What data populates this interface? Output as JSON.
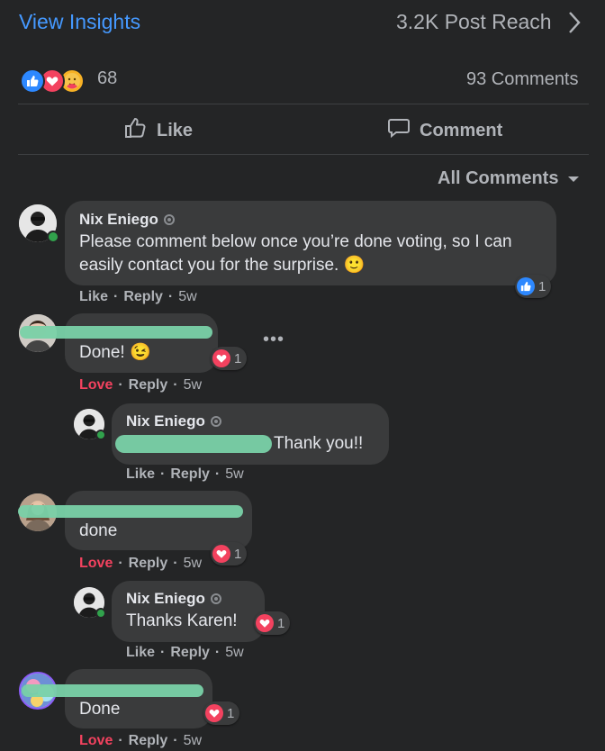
{
  "header": {
    "view_insights": "View Insights",
    "post_reach": "3.2K Post Reach"
  },
  "summary": {
    "reaction_count": "68",
    "comments_count": "93 Comments",
    "reaction_icons": [
      "like-icon",
      "love-icon",
      "care-icon"
    ]
  },
  "actions": {
    "like_label": "Like",
    "comment_label": "Comment"
  },
  "filter": {
    "label": "All Comments"
  },
  "comments": [
    {
      "author": "Nix Eniego",
      "text": "Please comment below once you’re done voting, so I can easily contact you for the surprise.",
      "emoji": "🙂",
      "reaction_count": "1",
      "actions": {
        "first": "Like",
        "reply": "Reply",
        "time": "5w"
      }
    },
    {
      "text": "Done!",
      "emoji": "😉",
      "reaction_count": "1",
      "actions": {
        "first": "Love",
        "reply": "Reply",
        "time": "5w"
      },
      "reply": {
        "author": "Nix Eniego",
        "text": "Thank you!!",
        "actions": {
          "first": "Like",
          "reply": "Reply",
          "time": "5w"
        }
      }
    },
    {
      "text": "done",
      "reaction_count": "1",
      "actions": {
        "first": "Love",
        "reply": "Reply",
        "time": "5w"
      },
      "reply": {
        "author": "Nix Eniego",
        "text": "Thanks Karen!",
        "reaction_count": "1",
        "actions": {
          "first": "Like",
          "reply": "Reply",
          "time": "5w"
        }
      }
    },
    {
      "text": "Done",
      "reaction_count": "1",
      "actions": {
        "first": "Love",
        "reply": "Reply",
        "time": "5w"
      }
    }
  ],
  "colors": {
    "background": "#242526",
    "bubble": "#3a3b3c",
    "accent_blue": "#4599ff",
    "love_red": "#f3425f",
    "redaction": "#79d1a8"
  }
}
